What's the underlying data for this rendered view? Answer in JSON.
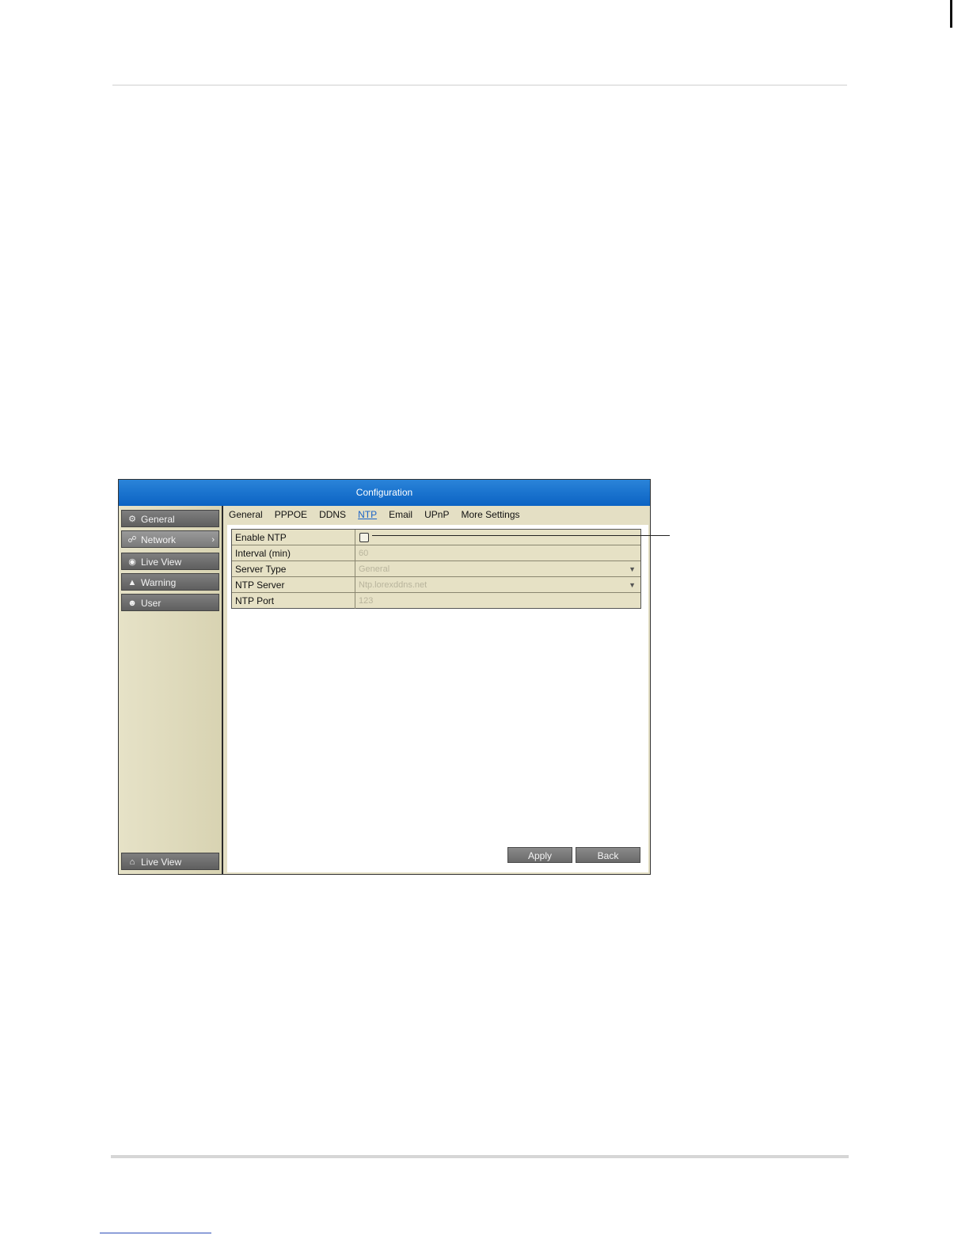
{
  "window": {
    "title": "Configuration"
  },
  "sidebar": {
    "items": [
      {
        "label": "General",
        "icon": "gear-icon",
        "active": false
      },
      {
        "label": "Network",
        "icon": "network-icon",
        "active": true
      },
      {
        "label": "Live View",
        "icon": "eye-icon",
        "active": false
      },
      {
        "label": "Warning",
        "icon": "warning-icon",
        "active": false
      },
      {
        "label": "User",
        "icon": "user-icon",
        "active": false
      }
    ],
    "bottom": {
      "label": "Live View",
      "icon": "home-icon"
    }
  },
  "tabs": [
    {
      "label": "General",
      "active": false
    },
    {
      "label": "PPPOE",
      "active": false
    },
    {
      "label": "DDNS",
      "active": false
    },
    {
      "label": "NTP",
      "active": true
    },
    {
      "label": "Email",
      "active": false
    },
    {
      "label": "UPnP",
      "active": false
    },
    {
      "label": "More Settings",
      "active": false
    }
  ],
  "ntp": {
    "enable_label": "Enable NTP",
    "enabled": false,
    "interval_label": "Interval (min)",
    "interval_value": "60",
    "server_type_label": "Server Type",
    "server_type_value": "General",
    "server_label": "NTP Server",
    "server_value": "Ntp.lorexddns.net",
    "port_label": "NTP Port",
    "port_value": "123"
  },
  "buttons": {
    "apply": "Apply",
    "back": "Back"
  },
  "colors": {
    "titlebar": "#0b63c3",
    "panel_bg": "#ded9bb",
    "active_tab": "#1a63c8"
  }
}
